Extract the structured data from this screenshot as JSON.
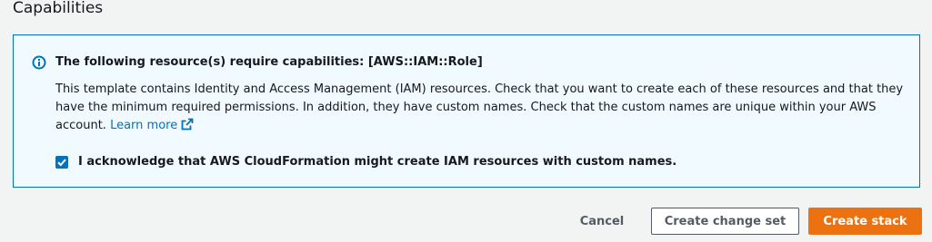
{
  "section": {
    "title": "Capabilities"
  },
  "alert": {
    "icon": "info-icon",
    "heading": "The following resource(s) require capabilities: [AWS::IAM::Role]",
    "body": "This template contains Identity and Access Management (IAM) resources. Check that you want to create each of these resources and that they have the minimum required permissions. In addition, they have custom names. Check that the custom names are unique within your AWS account.",
    "learn_more": "Learn more",
    "learn_more_icon": "external-link-icon",
    "accent_color": "#0073bb",
    "background_color": "#f1faff"
  },
  "acknowledgement": {
    "checked": true,
    "label": "I acknowledge that AWS CloudFormation might create IAM resources with custom names."
  },
  "actions": {
    "cancel": "Cancel",
    "create_change_set": "Create change set",
    "create_stack": "Create stack",
    "primary_color": "#ec7211"
  }
}
